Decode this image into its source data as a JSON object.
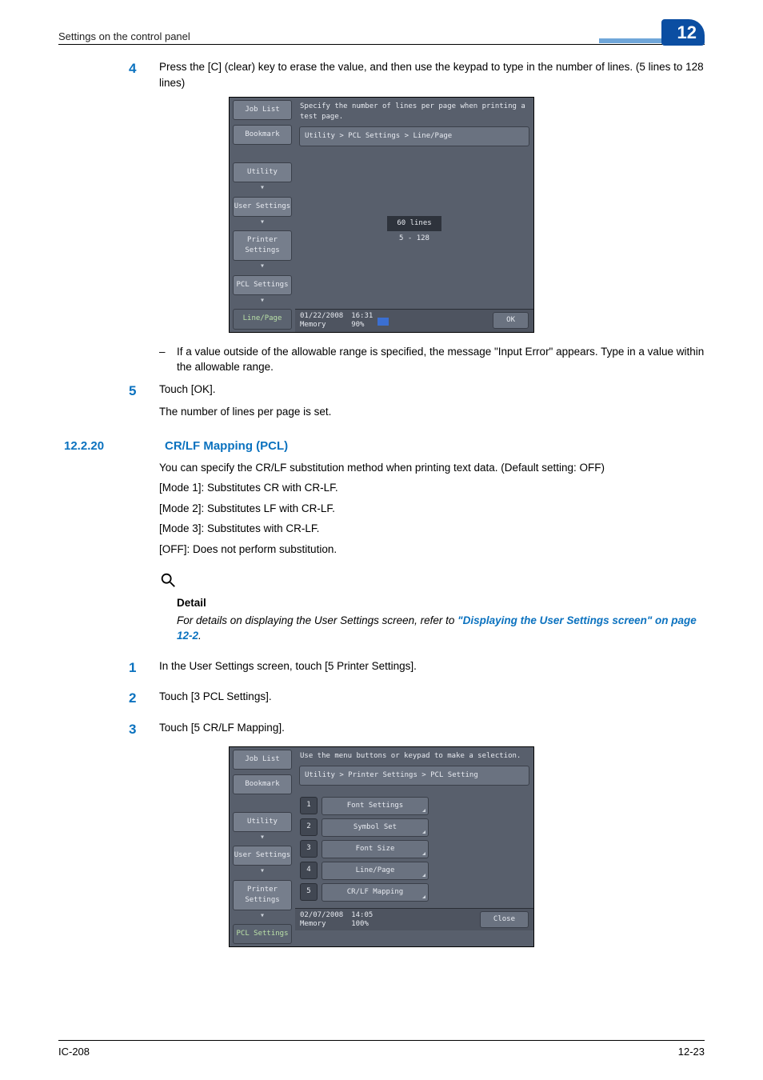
{
  "header": {
    "left": "Settings on the control panel",
    "chapter": "12"
  },
  "footer": {
    "left": "IC-208",
    "right": "12-23"
  },
  "step4": {
    "num": "4",
    "text": "Press the [C] (clear) key to erase the value, and then use the keypad to type in the number of lines. (5 lines to 128 lines)",
    "note": "If a value outside of the allowable range is specified, the message \"Input Error\" appears. Type in a value within the allowable range."
  },
  "step5": {
    "num": "5",
    "text": "Touch [OK].",
    "after": "The number of lines per page is set."
  },
  "section": {
    "num": "12.2.20",
    "title": "CR/LF Mapping (PCL)"
  },
  "paras": {
    "intro": "You can specify the CR/LF substitution method when printing text data. (Default setting: OFF)",
    "m1": "[Mode 1]: Substitutes CR with CR-LF.",
    "m2": "[Mode 2]: Substitutes LF with CR-LF.",
    "m3": "[Mode 3]: Substitutes with CR-LF.",
    "off": "[OFF]: Does not perform substitution."
  },
  "detail": {
    "label": "Detail",
    "body_pre": "For details on displaying the User Settings screen, refer to ",
    "xref": "\"Displaying the User Settings screen\" on page 12-2",
    "body_post": "."
  },
  "steps_b": {
    "s1n": "1",
    "s1": "In the User Settings screen, touch [5 Printer Settings].",
    "s2n": "2",
    "s2": "Touch [3 PCL Settings].",
    "s3n": "3",
    "s3": "Touch [5 CR/LF Mapping]."
  },
  "shot1": {
    "hint": "Specify the number of lines per page when printing a test page.",
    "path": "Utility > PCL Settings > Line/Page",
    "side": {
      "jobList": "Job List",
      "bookmark": "Bookmark",
      "utility": "Utility",
      "user": "User Settings",
      "printer": "Printer Settings",
      "pcl": "PCL Settings",
      "line": "Line/Page"
    },
    "value_main": "60  lines",
    "value_range": "5  -  128",
    "status": {
      "date": "01/22/2008",
      "memLabel": "Memory",
      "time": "16:31",
      "mem": "90%",
      "ok": "OK"
    }
  },
  "shot2": {
    "hint": "Use the menu buttons or keypad to make a selection.",
    "path": "Utility > Printer Settings > PCL Setting",
    "side": {
      "jobList": "Job List",
      "bookmark": "Bookmark",
      "utility": "Utility",
      "user": "User Settings",
      "printer": "Printer Settings",
      "pcl": "PCL Settings"
    },
    "menu": [
      {
        "idx": "1",
        "label": "Font Settings"
      },
      {
        "idx": "2",
        "label": "Symbol Set"
      },
      {
        "idx": "3",
        "label": "Font Size"
      },
      {
        "idx": "4",
        "label": "Line/Page"
      },
      {
        "idx": "5",
        "label": "CR/LF Mapping"
      }
    ],
    "status": {
      "date": "02/07/2008",
      "memLabel": "Memory",
      "time": "14:05",
      "mem": "100%",
      "close": "Close"
    }
  }
}
